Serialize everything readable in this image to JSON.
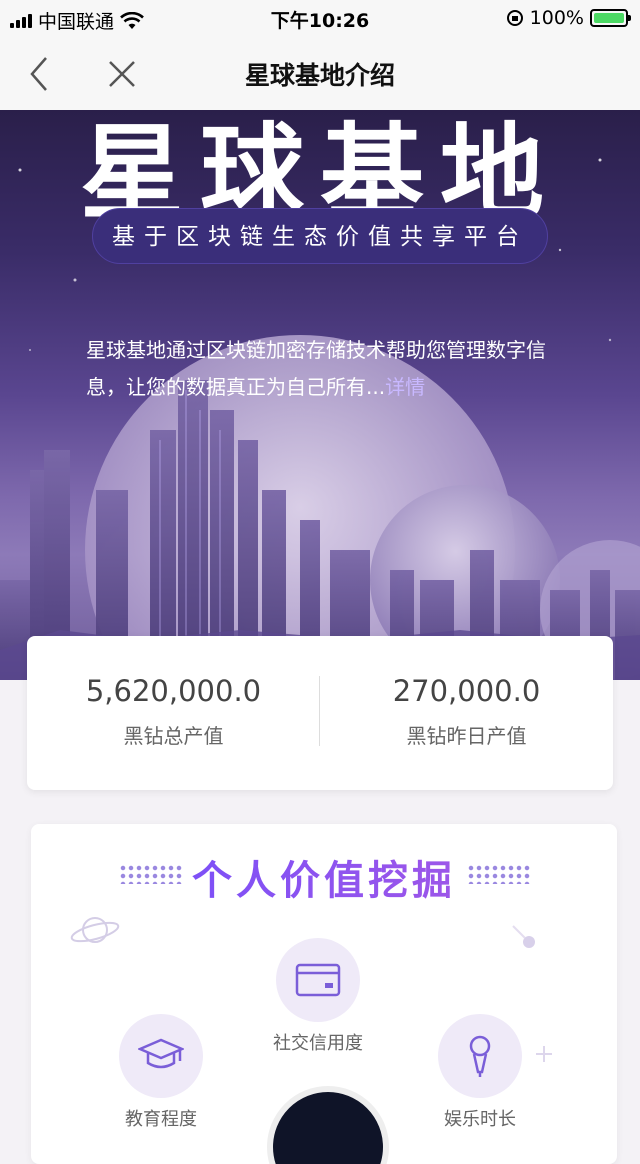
{
  "status_bar": {
    "carrier": "中国联通",
    "time": "下午10:26",
    "battery": "100%",
    "battery_level": 1.0
  },
  "nav": {
    "title": "星球基地介绍"
  },
  "hero": {
    "title": "星球基地",
    "subtitle": "基于区块链生态价值共享平台",
    "description": "星球基地通过区块链加密存储技术帮助您管理数字信息，让您的数据真正为自己所有...",
    "more_link": "详情"
  },
  "stats": {
    "total_value": "5,620,000.0",
    "total_label": "黑钻总产值",
    "yesterday_value": "270,000.0",
    "yesterday_label": "黑钻昨日产值"
  },
  "value_section": {
    "title": "个人价值挖掘",
    "items": [
      {
        "label": "社交信用度",
        "icon": "card-icon"
      },
      {
        "label": "教育程度",
        "icon": "graduation-cap-icon"
      },
      {
        "label": "娱乐时长",
        "icon": "microphone-icon"
      }
    ]
  },
  "colors": {
    "accent": "#7b5cff",
    "hero_dark": "#2a1f4a",
    "bubble_bg": "#efeaf8",
    "battery_green": "#4cd964"
  }
}
